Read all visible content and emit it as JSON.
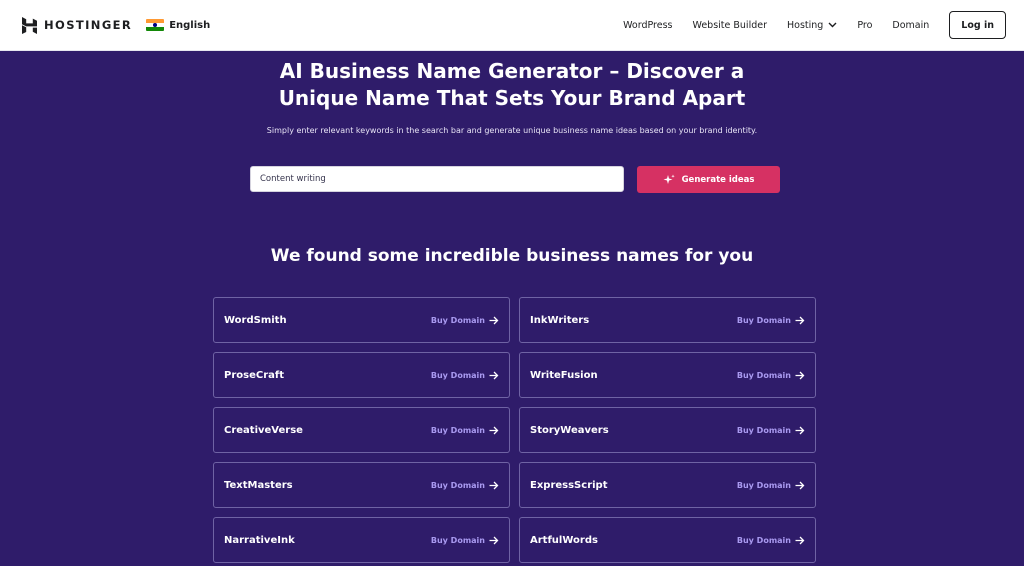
{
  "header": {
    "logo_text": "HOSTINGER",
    "language": "English",
    "nav": [
      {
        "label": "WordPress"
      },
      {
        "label": "Website Builder"
      },
      {
        "label": "Hosting"
      },
      {
        "label": "Pro"
      },
      {
        "label": "Domain"
      }
    ],
    "login_label": "Log in"
  },
  "hero": {
    "title_line1": "AI Business Name Generator – Discover a",
    "title_line2": "Unique Name That Sets Your Brand Apart",
    "subtitle": "Simply enter relevant keywords in the search bar and generate unique business name ideas based on your brand identity.",
    "search_value": "Content writing",
    "generate_label": "Generate ideas"
  },
  "results": {
    "title": "We found some incredible business names for you",
    "buy_label": "Buy Domain",
    "names": [
      "WordSmith",
      "InkWriters",
      "ProseCraft",
      "WriteFusion",
      "CreativeVerse",
      "StoryWeavers",
      "TextMasters",
      "ExpressScript",
      "NarrativeInk",
      "ArtfulWords"
    ]
  },
  "colors": {
    "background": "#2f1c6a",
    "accent": "#d63163",
    "link": "#a99af0"
  }
}
